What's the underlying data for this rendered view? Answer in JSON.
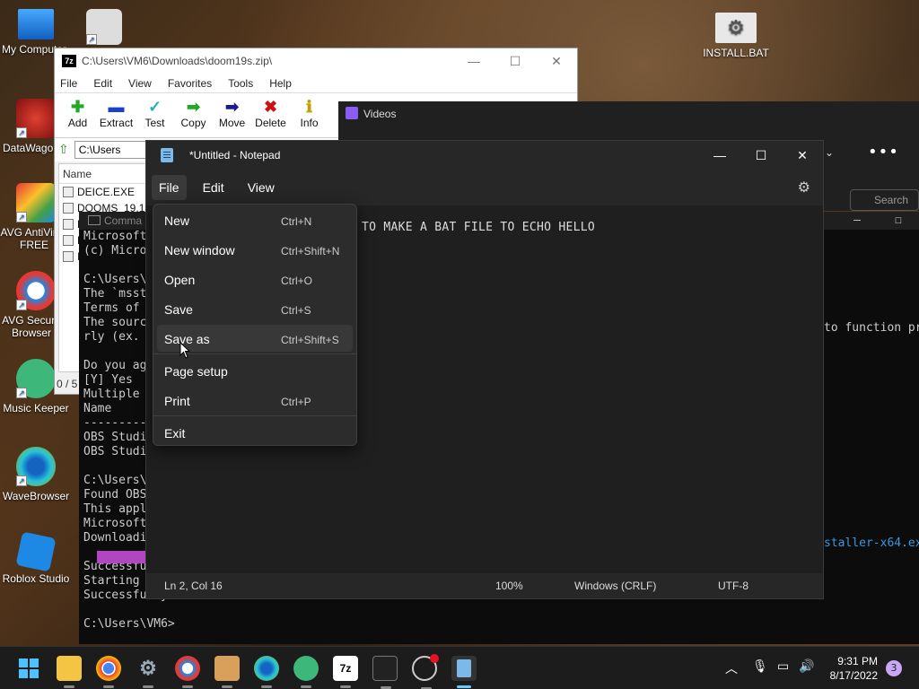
{
  "desktop": {
    "icons": [
      {
        "label": "My Computer"
      },
      {
        "label": "DataWagon"
      },
      {
        "label": "AVG AntiVirus FREE"
      },
      {
        "label": "AVG Secure Browser"
      },
      {
        "label": "Music Keeper"
      },
      {
        "label": "WaveBrowser"
      },
      {
        "label": "Roblox Studio"
      },
      {
        "label": "INSTALL.BAT"
      }
    ]
  },
  "sevenzip": {
    "title": "C:\\Users\\VM6\\Downloads\\doom19s.zip\\",
    "menu": [
      "File",
      "Edit",
      "View",
      "Favorites",
      "Tools",
      "Help"
    ],
    "toolbar": [
      "Add",
      "Extract",
      "Test",
      "Copy",
      "Move",
      "Delete",
      "Info"
    ],
    "address": "C:\\Users",
    "column_name": "Name",
    "files": [
      "DEICE.EXE",
      "DOOMS_19.1",
      "D",
      "D",
      "IN"
    ],
    "status": "0 / 5 c"
  },
  "console": {
    "title": "Comma",
    "lines": "Microsoft\n(c) Micro\n\nC:\\Users\\\nThe `msst\nTerms of\nThe sourc\nrly (ex.\n\nDo you ag\n[Y] Yes\nMultiple\nName\n---------\nOBS Studi\nOBS Studi\n\nC:\\Users\\\nFound OBS\nThis appl\nMicrosoft\nDownloadi\n\nSuccessfu\nStarting\nSuccessfully installed\n\nC:\\Users\\VM6>",
    "right_text": "to function pr",
    "right_text2": "staller-x64.ex"
  },
  "videos": {
    "title": "Videos",
    "search_placeholder": "Search"
  },
  "notepad": {
    "title": "*Untitled - Notepad",
    "menu": [
      "File",
      "Edit",
      "View"
    ],
    "content": "TO MAKE A BAT FILE TO ECHO HELLO",
    "status": {
      "position": "Ln 2, Col 16",
      "zoom": "100%",
      "line_ending": "Windows (CRLF)",
      "encoding": "UTF-8"
    }
  },
  "file_menu": {
    "items": [
      {
        "label": "New",
        "shortcut": "Ctrl+N"
      },
      {
        "label": "New window",
        "shortcut": "Ctrl+Shift+N"
      },
      {
        "label": "Open",
        "shortcut": "Ctrl+O"
      },
      {
        "label": "Save",
        "shortcut": "Ctrl+S"
      },
      {
        "label": "Save as",
        "shortcut": "Ctrl+Shift+S"
      },
      {
        "label": "Page setup",
        "shortcut": ""
      },
      {
        "label": "Print",
        "shortcut": "Ctrl+P"
      },
      {
        "label": "Exit",
        "shortcut": ""
      }
    ]
  },
  "taskbar": {
    "clock_time": "9:31 PM",
    "clock_date": "8/17/2022",
    "notification_count": "3",
    "icons": [
      "windows-start-icon",
      "file-explorer-icon",
      "chrome-icon",
      "settings-icon",
      "avg-browser-icon",
      "archive-icon",
      "wavebrowser-icon",
      "music-keeper-icon",
      "7zip-icon",
      "terminal-icon",
      "obs-icon",
      "notepad-icon"
    ],
    "sevenzip_label": "7z"
  },
  "colors": {
    "accent": "#60cdff",
    "notepad_bg": "#272727",
    "console_bg": "#0c0c0c"
  }
}
